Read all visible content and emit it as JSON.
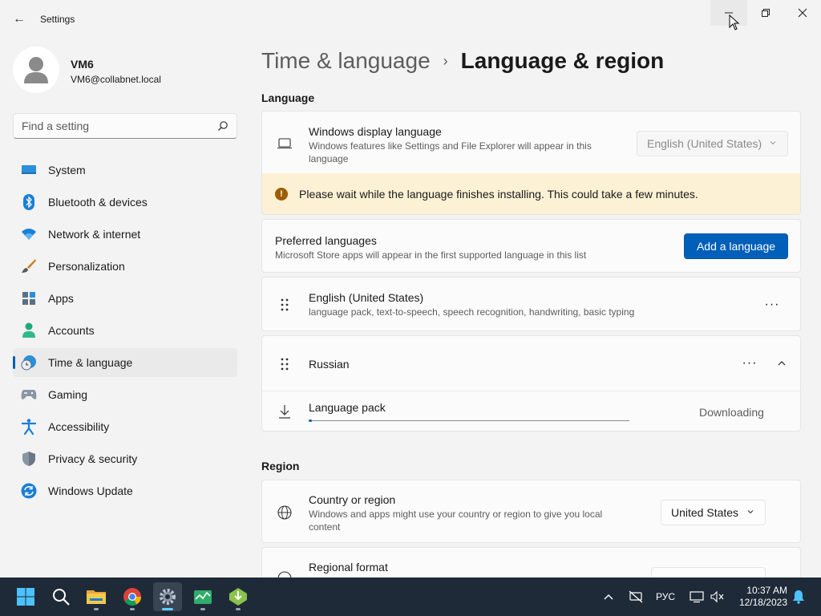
{
  "window": {
    "app_title": "Settings",
    "back_glyph": "←",
    "minimize_glyph": "—",
    "maximize_glyph": "❐",
    "close_glyph": "✕"
  },
  "profile": {
    "name": "VM6",
    "email": "VM6@collabnet.local"
  },
  "search": {
    "placeholder": "Find a setting"
  },
  "sidebar": {
    "items": [
      {
        "label": "System",
        "icon": "monitor-icon"
      },
      {
        "label": "Bluetooth & devices",
        "icon": "bluetooth-icon"
      },
      {
        "label": "Network & internet",
        "icon": "wifi-icon"
      },
      {
        "label": "Personalization",
        "icon": "brush-icon"
      },
      {
        "label": "Apps",
        "icon": "apps-icon"
      },
      {
        "label": "Accounts",
        "icon": "person-icon"
      },
      {
        "label": "Time & language",
        "icon": "clock-globe-icon",
        "active": true
      },
      {
        "label": "Gaming",
        "icon": "gamepad-icon"
      },
      {
        "label": "Accessibility",
        "icon": "accessibility-icon"
      },
      {
        "label": "Privacy & security",
        "icon": "shield-icon"
      },
      {
        "label": "Windows Update",
        "icon": "update-icon"
      }
    ]
  },
  "breadcrumb": {
    "parent": "Time & language",
    "separator": "›",
    "current": "Language & region"
  },
  "language": {
    "section_title": "Language",
    "display_language": {
      "title": "Windows display language",
      "description": "Windows features like Settings and File Explorer will appear in this language",
      "selected": "English (United States)"
    },
    "banner": {
      "icon_glyph": "!",
      "text": "Please wait while the language finishes installing. This could take a few minutes."
    },
    "preferred": {
      "title": "Preferred languages",
      "description": "Microsoft Store apps will appear in the first supported language in this list",
      "add_button": "Add a language"
    },
    "items": [
      {
        "name": "English (United States)",
        "features": "language pack, text-to-speech, speech recognition, handwriting, basic typing",
        "more_glyph": "···"
      },
      {
        "name": "Russian",
        "more_glyph": "···",
        "expanded": true,
        "pack": {
          "title": "Language pack",
          "status": "Downloading",
          "progress": 0.01
        }
      }
    ]
  },
  "region": {
    "section_title": "Region",
    "country": {
      "title": "Country or region",
      "description": "Windows and apps might use your country or region to give you local content",
      "selected": "United States"
    },
    "format": {
      "title": "Regional format"
    }
  },
  "taskbar": {
    "apps": [
      "start-icon",
      "search-icon",
      "file-explorer-icon",
      "chrome-icon",
      "settings-icon",
      "task-manager-icon",
      "installer-icon"
    ],
    "input_language": "РУС",
    "time": "10:37 AM",
    "date": "12/18/2023"
  },
  "colors": {
    "accent": "#005fb8",
    "banner_bg": "#fcf1d4",
    "warning_icon": "#9d5d00",
    "taskbar_bg": "#1f2a38"
  }
}
